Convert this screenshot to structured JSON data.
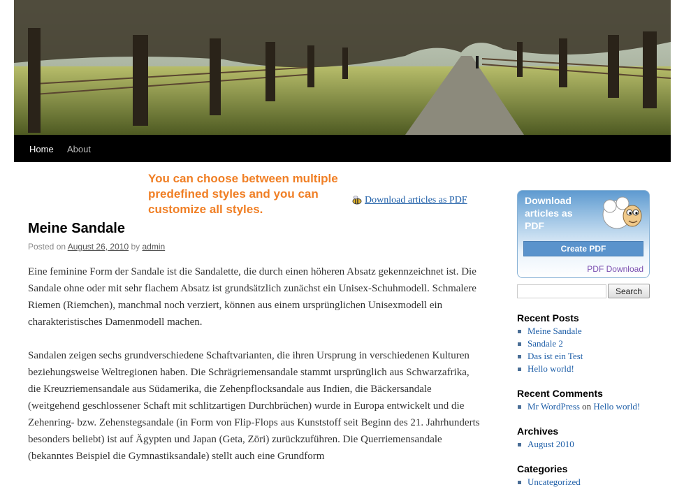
{
  "nav": {
    "home": "Home",
    "about": "About"
  },
  "promo": {
    "text": "You can choose between multiple predefined styles and you can customize all styles."
  },
  "pdf_link": {
    "label": "Download articles as PDF"
  },
  "post": {
    "title": "Meine Sandale",
    "posted_on": "Posted on",
    "date": "August 26, 2010",
    "by": "by",
    "author": "admin",
    "paragraphs": [
      "Eine feminine Form der Sandale ist die Sandalette, die durch einen höheren Absatz gekennzeichnet ist. Die Sandale ohne oder mit sehr flachem Absatz ist grundsätzlich zunächst ein Unisex-Schuhmodell. Schmalere Riemen (Riemchen), manchmal noch verziert, können aus einem ursprünglichen Unisexmodell ein charakteristisches Damenmodell machen.",
      "Sandalen zeigen sechs grundverschiedene Schaftvarianten, die ihren Ursprung in verschiedenen Kulturen beziehungsweise Weltregionen haben. Die Schrägriemensandale stammt ursprünglich aus Schwarzafrika, die Kreuzriemensandale aus Südamerika, die Zehenpflocksandale aus Indien, die Bäckersandale (weitgehend geschlossener Schaft mit schlitzartigen Durchbrüchen) wurde in Europa entwickelt und die Zehenring- bzw. Zehenstegsandale (in Form von Flip-Flops aus Kunststoff seit Beginn des 21. Jahrhunderts besonders beliebt) ist auf Ägypten und Japan (Geta, Zōri) zurückzuführen. Die Querriemensandale (bekanntes Beispiel die Gymnastiksandale) stellt auch eine Grundform"
    ]
  },
  "sidebar": {
    "pdf_widget": {
      "title": "Download articles as PDF",
      "button": "Create PDF",
      "footer": "PDF Download"
    },
    "search": {
      "button": "Search",
      "value": ""
    },
    "recent_posts": {
      "title": "Recent Posts",
      "items": [
        "Meine Sandale",
        "Sandale 2",
        "Das ist ein Test",
        "Hello world!"
      ]
    },
    "recent_comments": {
      "title": "Recent Comments",
      "author": "Mr WordPress",
      "on": "on",
      "post": "Hello world!"
    },
    "archives": {
      "title": "Archives",
      "items": [
        "August 2010"
      ]
    },
    "categories": {
      "title": "Categories",
      "items": [
        "Uncategorized"
      ]
    }
  },
  "colors": {
    "promo": "#f07f25",
    "link": "#1f5fa8",
    "nav_bg": "#000000"
  }
}
